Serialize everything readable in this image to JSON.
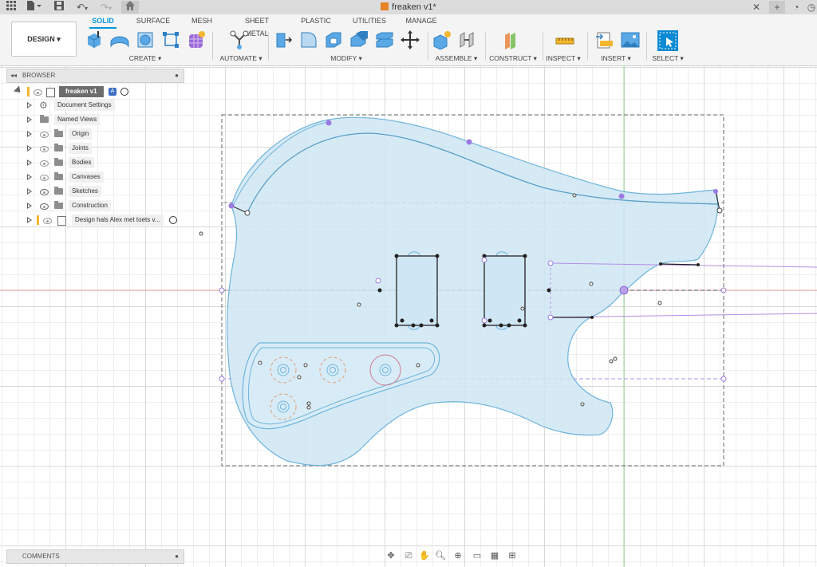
{
  "app": {
    "document_title": "freaken v1*"
  },
  "ribbon": {
    "workspace_button": "DESIGN ▾",
    "tabs": [
      "SOLID",
      "SURFACE",
      "MESH",
      "SHEET METAL",
      "PLASTIC",
      "UTILITIES",
      "MANAGE"
    ],
    "active_tab": "SOLID",
    "groups": [
      "CREATE ▾",
      "AUTOMATE ▾",
      "MODIFY ▾",
      "ASSEMBLE ▾",
      "CONSTRUCT ▾",
      "INSPECT ▾",
      "INSERT ▾",
      "SELECT ▾"
    ]
  },
  "browser": {
    "title": "BROWSER",
    "root": "freaken v1",
    "items": [
      {
        "label": "Document Settings",
        "icon": "gear-icon"
      },
      {
        "label": "Named Views",
        "icon": "folder-icon"
      },
      {
        "label": "Origin",
        "icon": "folder-icon"
      },
      {
        "label": "Joints",
        "icon": "folder-icon"
      },
      {
        "label": "Bodies",
        "icon": "folder-icon"
      },
      {
        "label": "Canvases",
        "icon": "folder-icon"
      },
      {
        "label": "Sketches",
        "icon": "folder-icon"
      },
      {
        "label": "Construction",
        "icon": "folder-icon"
      },
      {
        "label": "Design hals Alex met toets v...",
        "icon": "component-icon"
      }
    ]
  },
  "comments": {
    "title": "COMMENTS"
  },
  "colors": {
    "accent": "#0696d7",
    "body_fill": "#cfe6f5",
    "body_stroke": "#6fb4db",
    "constraint_purple": "#b28ee6"
  }
}
